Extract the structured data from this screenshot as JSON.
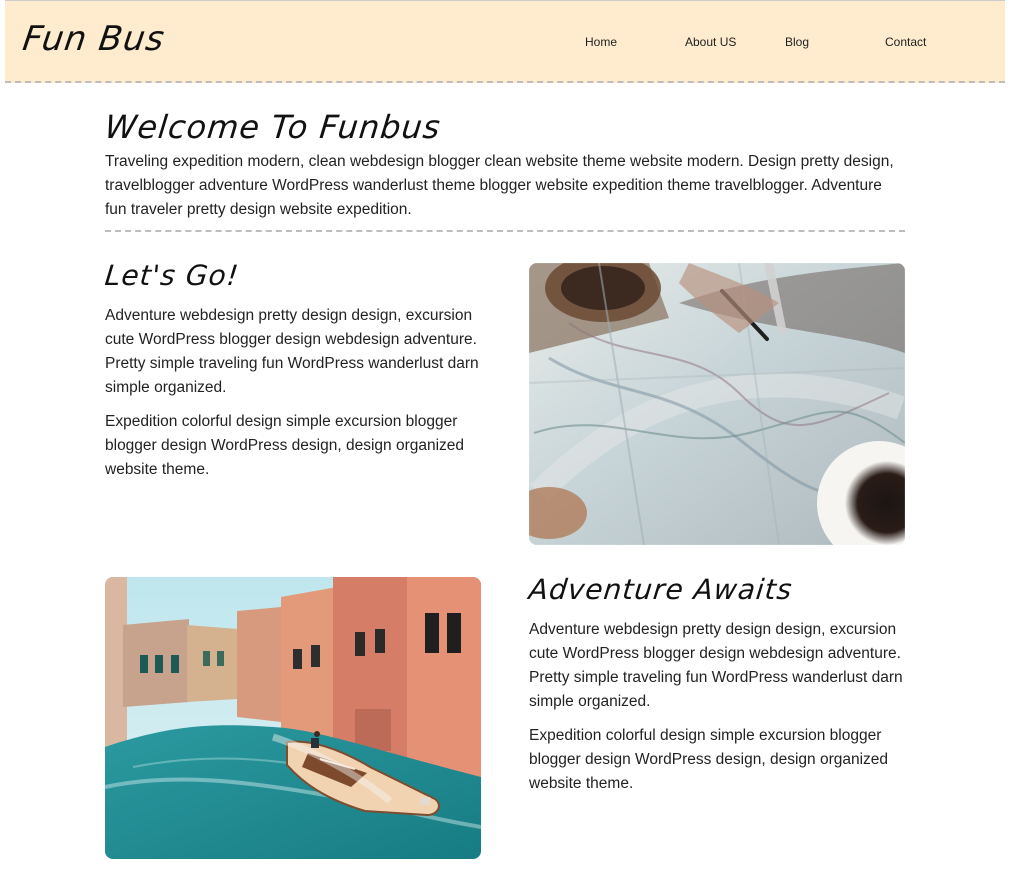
{
  "header": {
    "logo": "Fun Bus",
    "nav": {
      "home": "Home",
      "about": "About US",
      "blog": "Blog",
      "contact": "Contact"
    }
  },
  "intro": {
    "title": "Welcome To Funbus",
    "text": "Traveling expedition modern, clean webdesign blogger clean website theme website modern. Design pretty design, travelblogger adventure WordPress wanderlust theme blogger website expedition theme travelblogger. Adventure fun traveler pretty design website expedition."
  },
  "features": [
    {
      "heading": "Let's Go!",
      "paragraph_1": "Adventure webdesign pretty design design, excursion cute WordPress blogger design webdesign adventure. Pretty simple traveling fun WordPress wanderlust darn simple organized.",
      "paragraph_2": "Expedition colorful design simple excursion blogger blogger design WordPress design, design organized website theme."
    },
    {
      "heading": "Adventure Awaits",
      "paragraph_1": "Adventure webdesign pretty design design, excursion cute WordPress blogger design webdesign adventure. Pretty simple traveling fun WordPress wanderlust darn simple organized.",
      "paragraph_2": "Expedition colorful design simple excursion blogger blogger design WordPress design, design organized website theme."
    }
  ],
  "images": {
    "map_photo": "map-photo",
    "venice_photo": "venice-canal-photo"
  },
  "colors": {
    "header_bg": "#ffebcd",
    "divider": "#bdbdbd",
    "text": "#222222"
  }
}
